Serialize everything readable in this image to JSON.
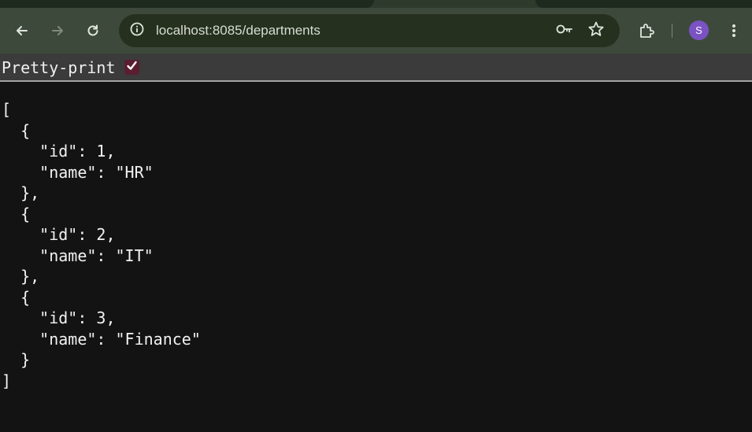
{
  "browser": {
    "url": "localhost:8085/departments",
    "profile_initial": "S",
    "icons": [
      "back-icon",
      "forward-icon",
      "reload-icon",
      "site-info-icon",
      "password-key-icon",
      "bookmark-star-icon",
      "extensions-icon",
      "menu-kebab-icon"
    ]
  },
  "viewer": {
    "pretty_print_label": "Pretty-print",
    "pretty_print_checked": true
  },
  "json_text": "[\n  {\n    \"id\": 1,\n    \"name\": \"HR\"\n  },\n  {\n    \"id\": 2,\n    \"name\": \"IT\"\n  },\n  {\n    \"id\": 3,\n    \"name\": \"Finance\"\n  }\n]"
}
